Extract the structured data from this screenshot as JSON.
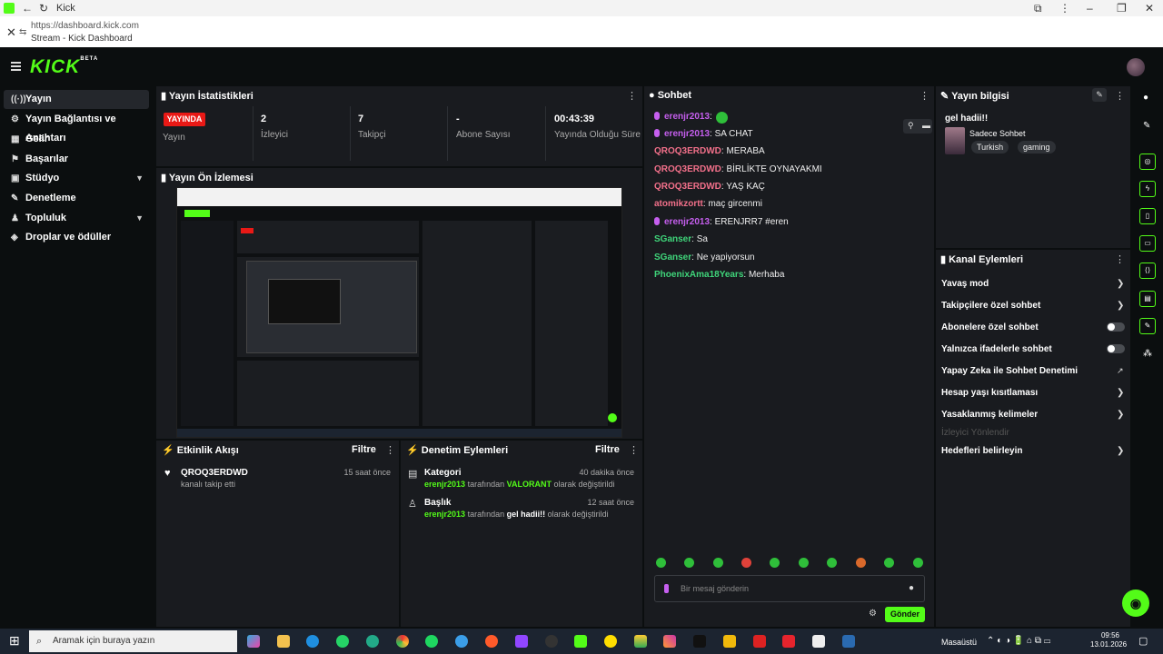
{
  "browser": {
    "tab_title": "Kick",
    "url": "https://dashboard.kick.com",
    "page_title": "Stream - Kick Dashboard"
  },
  "app": {
    "logo": "KICK",
    "logo_badge": "BETA"
  },
  "sidebar": {
    "items": [
      {
        "label": "Yayın",
        "icon": "broadcast-icon",
        "active": true
      },
      {
        "label": "Yayın Bağlantısı ve Anahtarı",
        "icon": "link-icon"
      },
      {
        "label": "Gelir",
        "icon": "money-icon"
      },
      {
        "label": "Başarılar",
        "icon": "flag-icon"
      },
      {
        "label": "Stüdyo",
        "icon": "studio-icon",
        "expandable": true
      },
      {
        "label": "Denetleme",
        "icon": "wrench-icon"
      },
      {
        "label": "Topluluk",
        "icon": "community-icon",
        "expandable": true
      },
      {
        "label": "Droplar ve ödüller",
        "icon": "gift-icon"
      }
    ]
  },
  "stats": {
    "title": "Yayın İstatistikleri",
    "live_badge": "YAYINDA",
    "live_label": "Yayın",
    "viewers_value": "2",
    "viewers_label": "İzleyici",
    "followers_value": "7",
    "followers_label": "Takipçi",
    "subs_value": "-",
    "subs_label": "Abone Sayısı",
    "uptime_value": "00:43:39",
    "uptime_label": "Yayında Olduğu Süre"
  },
  "preview": {
    "title": "Yayın Ön İzlemesi"
  },
  "activity": {
    "title": "Etkinlik Akışı",
    "filter": "Filtre",
    "items": [
      {
        "user": "QROQ3ERDWD",
        "text": "kanalı takip etti",
        "time": "15 saat önce"
      }
    ]
  },
  "moderation": {
    "title": "Denetim Eylemleri",
    "filter": "Filtre",
    "items": [
      {
        "title": "Kategori",
        "user": "erenjr2013",
        "mid": "tarafından",
        "value": "VALORANT",
        "suffix": "olarak değiştirildi",
        "time": "40 dakika önce"
      },
      {
        "title": "Başlık",
        "user": "erenjr2013",
        "mid": "tarafından",
        "value": "gel hadii!!",
        "suffix": "olarak değiştirildi",
        "time": "12 saat önce"
      }
    ]
  },
  "chat": {
    "title": "Sohbet",
    "messages": [
      {
        "user": "erenjr2013",
        "text": ":",
        "color": "#c65fef",
        "mic": true
      },
      {
        "user": "erenjr2013",
        "text": ": SA CHAT",
        "color": "#c65fef",
        "mic": true
      },
      {
        "user": "QROQ3ERDWD",
        "text": ": MERABA",
        "color": "#f2708a",
        "mic": false
      },
      {
        "user": "QROQ3ERDWD",
        "text": ": BİRLİKTE OYNAYAKMI",
        "color": "#f2708a",
        "mic": false
      },
      {
        "user": "QROQ3ERDWD",
        "text": ": YAŞ KAÇ",
        "color": "#f2708a",
        "mic": false
      },
      {
        "user": "atomikzortt",
        "text": ": maç gircenmi",
        "color": "#f2708a",
        "mic": false
      },
      {
        "user": "erenjr2013",
        "text": ": ERENJRR7 #eren",
        "color": "#c65fef",
        "mic": true
      },
      {
        "user": "SGanser",
        "text": ": Sa",
        "color": "#3fd57a",
        "mic": false
      },
      {
        "user": "SGanser",
        "text": ": Ne yapiyorsun",
        "color": "#3fd57a",
        "mic": false
      },
      {
        "user": "PhoenixAma18Years",
        "text": ": Merhaba",
        "color": "#3fd57a",
        "mic": false
      }
    ],
    "input_placeholder": "Bir mesaj gönderin",
    "send_label": "Gönder"
  },
  "stream_info": {
    "title": "Yayın bilgisi",
    "stream_title": "gel hadii!!",
    "chat_mode": "Sadece Sohbet",
    "tags": [
      "Turkish",
      "gaming"
    ]
  },
  "channel_actions": {
    "title": "Kanal Eylemleri",
    "items": [
      {
        "label": "Yavaş mod",
        "control": "chevron"
      },
      {
        "label": "Takipçilere özel sohbet",
        "control": "chevron"
      },
      {
        "label": "Abonelere özel sohbet",
        "control": "toggle"
      },
      {
        "label": "Yalnızca ifadelerle sohbet",
        "control": "toggle"
      },
      {
        "label": "Yapay Zeka ile Sohbet Denetimi",
        "control": "external"
      },
      {
        "label": "Hesap yaşı kısıtlaması",
        "control": "chevron"
      },
      {
        "label": "Yasaklanmış kelimeler",
        "control": "chevron"
      },
      {
        "label": "İzleyici Yönlendir",
        "control": "disabled"
      },
      {
        "label": "Hedefleri belirleyin",
        "control": "chevron"
      }
    ]
  },
  "taskbar": {
    "search_placeholder": "Aramak için buraya yazın",
    "desktop_label": "Masaüstü",
    "time": "09:56",
    "date": "13.01.2026"
  },
  "colors": {
    "accent": "#53fc18",
    "live": "#e91916",
    "panel": "#191b1f",
    "background": "#0b0e0f"
  }
}
